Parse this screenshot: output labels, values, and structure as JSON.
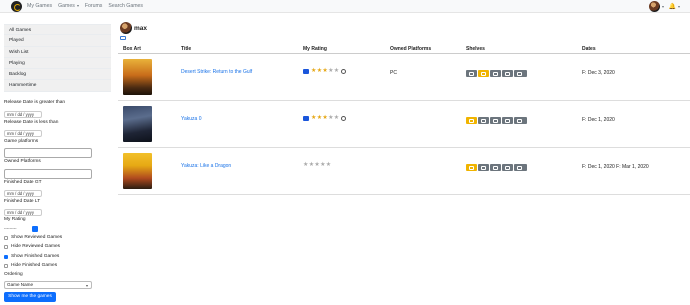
{
  "nav": {
    "links": [
      "My Games",
      "Games",
      "Forums",
      "Search Games"
    ]
  },
  "sidebar": {
    "lists": [
      "All Games",
      "Played",
      "Wish List",
      "Playing",
      "Backlog",
      "Hammertime"
    ],
    "release_gt_label": "Release Date is greater than",
    "release_lt_label": "Release Date is less than",
    "date_placeholder": "mm / dd / yyyy",
    "platforms_label": "Game platforms",
    "owned_label": "Owned Platforms",
    "finished_gt_label": "Finished Date GT",
    "finished_lt_label": "Finished Date LT",
    "my_rating_label": "My Rating",
    "my_rating_value": "---------",
    "checkboxes": [
      {
        "label": "Show Reviewed Games",
        "checked": false
      },
      {
        "label": "Hide Reviewed Games",
        "checked": false
      },
      {
        "label": "Show Finished Games",
        "checked": true
      },
      {
        "label": "Hide Finished Games",
        "checked": false
      }
    ],
    "ordering_label": "Ordering",
    "ordering_value": "Game Name",
    "submit_label": "Show me the games"
  },
  "user": {
    "name": "max"
  },
  "table": {
    "headers": [
      "Box Art",
      "Title",
      "My Rating",
      "Owned Platforms",
      "Shelves",
      "Dates"
    ],
    "rows": [
      {
        "title": "Desert Strike: Return to the Gulf",
        "rating": 3,
        "rated": true,
        "platform": "PC",
        "active_shelf": 1,
        "dates": "F: Dec 3, 2020"
      },
      {
        "title": "Yakuza 0",
        "rating": 3,
        "rated": true,
        "platform": "",
        "active_shelf": 0,
        "dates": "F: Dec 1, 2020"
      },
      {
        "title": "Yakuza: Like a Dragon",
        "rating": 0,
        "rated": false,
        "platform": "",
        "active_shelf": 0,
        "dates": "F: Dec 1, 2020 F: Mar 1, 2020"
      }
    ]
  },
  "colors": {
    "primary": "#0d6efd",
    "shelf_active": "#f0b400",
    "shelf": "#6c757d",
    "link": "#1a73e8",
    "star": "#e6a817"
  }
}
